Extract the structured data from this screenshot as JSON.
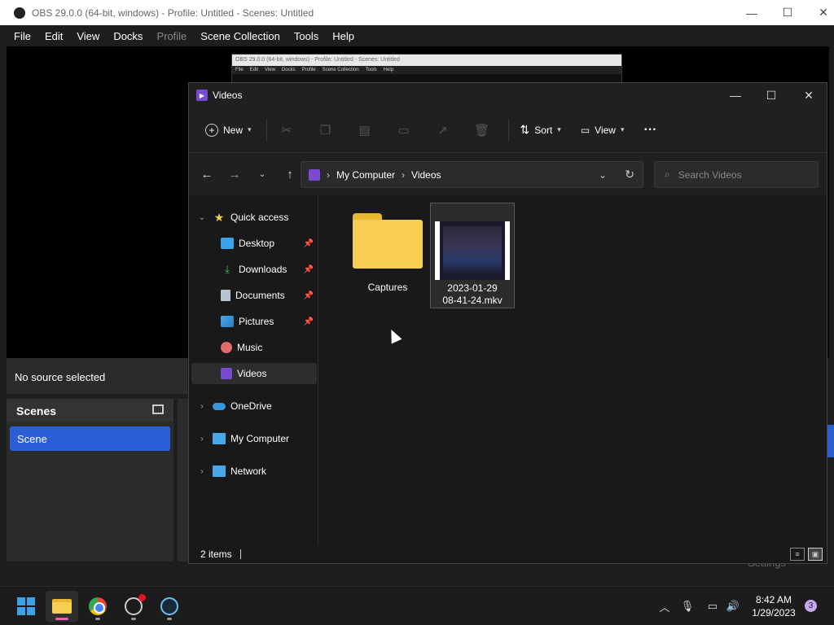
{
  "obs": {
    "title": "OBS 29.0.0 (64-bit, windows) - Profile: Untitled - Scenes: Untitled",
    "menu": [
      "File",
      "Edit",
      "View",
      "Docks",
      "Profile",
      "Scene Collection",
      "Tools",
      "Help"
    ],
    "mini_title": "OBS 29.0.0 (64-bit, windows) - Profile: Untitled - Scenes: Untitled",
    "mini_menu": [
      "File",
      "Edit",
      "View",
      "Docks",
      "Profile",
      "Scene Collection",
      "Tools",
      "Help"
    ],
    "no_source": "No source selected",
    "scenes_header": "Scenes",
    "scene_item": "Scene",
    "settings_ghost": "Settings"
  },
  "explorer": {
    "title": "Videos",
    "toolbar": {
      "new_label": "New",
      "sort_label": "Sort",
      "view_label": "View",
      "more_label": "···"
    },
    "breadcrumb": [
      "My Computer",
      "Videos"
    ],
    "search_placeholder": "Search Videos",
    "nav": {
      "quick_access": "Quick access",
      "pinned": [
        {
          "label": "Desktop",
          "icon": "desktop-icon",
          "pinned": true
        },
        {
          "label": "Downloads",
          "icon": "download-icon",
          "pinned": true
        },
        {
          "label": "Documents",
          "icon": "document-icon",
          "pinned": true
        },
        {
          "label": "Pictures",
          "icon": "picture-icon",
          "pinned": true
        },
        {
          "label": "Music",
          "icon": "music-icon",
          "pinned": false
        },
        {
          "label": "Videos",
          "icon": "video-icon",
          "pinned": false,
          "selected": true
        }
      ],
      "onedrive": "OneDrive",
      "my_computer": "My Computer",
      "network": "Network"
    },
    "files": [
      {
        "name": "Captures",
        "type": "folder"
      },
      {
        "name_line1": "2023-01-29",
        "name_line2": "08-41-24.mkv",
        "type": "video",
        "selected": true
      }
    ],
    "status": "2 items"
  },
  "taskbar": {
    "apps": [
      "start-icon",
      "file-explorer-icon",
      "chrome-icon",
      "obs-icon",
      "steam-icon"
    ],
    "time": "8:42 AM",
    "date": "1/29/2023",
    "notification_count": "3"
  }
}
